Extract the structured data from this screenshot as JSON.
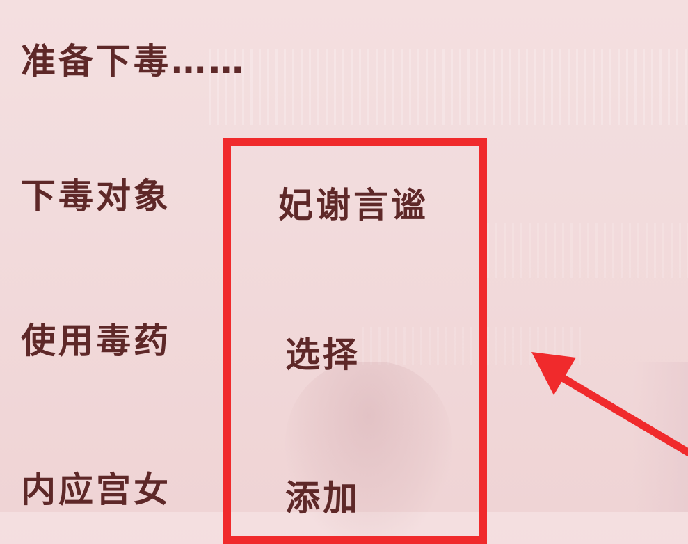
{
  "heading": "准备下毒……",
  "rows": [
    {
      "label": "下毒对象",
      "value": "妃谢言谧"
    },
    {
      "label": "使用毒药",
      "value": "选择"
    },
    {
      "label": "内应宫女",
      "value": "添加"
    }
  ],
  "colors": {
    "text": "#5e2828",
    "annotation": "#f02a2c",
    "background": "#f3dcdd"
  }
}
